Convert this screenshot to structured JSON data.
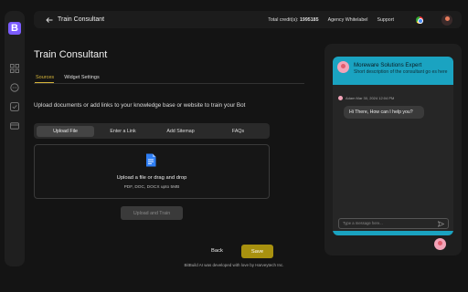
{
  "rail": {
    "logo": "B",
    "icons": [
      "grid-icon",
      "chat-icon",
      "check-square-icon",
      "card-icon"
    ]
  },
  "topbar": {
    "title": "Train Consultant",
    "credits_label": "Total credit(s):",
    "credits_value": "1995185",
    "agency": "Agency Whitelabel",
    "support": "Support"
  },
  "page": {
    "title": "Train Consultant",
    "tabs": [
      "Sources",
      "Widget Settings"
    ],
    "active_tab": "Sources",
    "instructions": "Upload documents or add links to your knowledge base or website to train your Bot"
  },
  "segments": [
    "Upload File",
    "Enter a Link",
    "Add Sitemap",
    "FAQs"
  ],
  "dropzone": {
    "title": "Upload a file or drag and drop",
    "subtitle": "PDF, DOC, DOCX upto 5MB"
  },
  "buttons": {
    "upload_train": "Upload and Train",
    "back": "Back",
    "save": "Save"
  },
  "footer": "BitBuild AI was developed with love by Harveytech Inc.",
  "chat": {
    "name": "Moreware Solutions Expert",
    "description": "Short description of the consultant go es here",
    "message_meta": "Adam Mar 30, 2024 12:04 PM",
    "message": "Hi There, How can I help you?",
    "input_placeholder": "Type a message here..."
  },
  "colors": {
    "accent": "#d6b53a",
    "save": "#a8910f",
    "chat_header": "#1aa3c1",
    "logo": "#7b5cff"
  }
}
